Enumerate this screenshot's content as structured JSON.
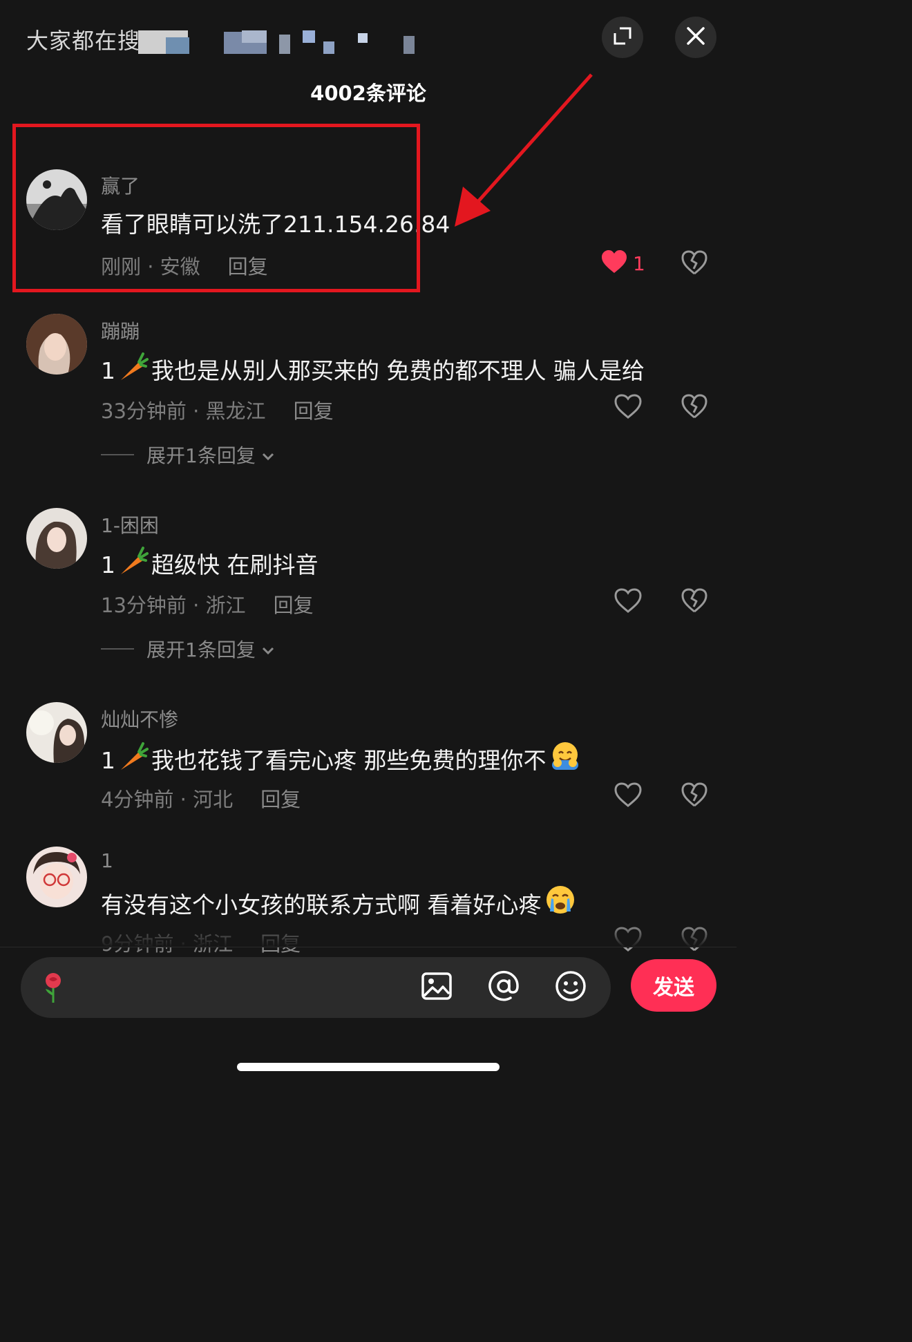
{
  "header": {
    "search_hint": "大家都在搜",
    "comment_count": "4002条评论"
  },
  "comments": [
    {
      "username": "赢了",
      "text": "看了眼睛可以洗了211.154.26.84",
      "time_location": "刚刚 · 安徽",
      "reply_label": "回复",
      "likes": "1",
      "liked": true
    },
    {
      "username": "蹦蹦",
      "prefix": "1",
      "text": "我也是从别人那买来的 免费的都不理人 骗人是给",
      "time_location": "33分钟前 · 黑龙江",
      "reply_label": "回复",
      "expand_label": "展开1条回复"
    },
    {
      "username": "1-困困",
      "prefix": "1",
      "text": "超级快 在刷抖音",
      "time_location": "13分钟前 · 浙江",
      "reply_label": "回复",
      "expand_label": "展开1条回复"
    },
    {
      "username": "灿灿不惨",
      "prefix": "1",
      "text": "我也花钱了看完心疼 那些免费的理你不",
      "time_location": "4分钟前 · 河北",
      "reply_label": "回复"
    },
    {
      "username": "1",
      "text": "有没有这个小女孩的联系方式啊 看着好心疼",
      "time_location": "9分钟前 · 浙江",
      "reply_label": "回复"
    }
  ],
  "input_bar": {
    "send_label": "发送"
  },
  "colors": {
    "accent": "#ff2f55",
    "highlight": "#e3171f",
    "background": "#161616"
  }
}
